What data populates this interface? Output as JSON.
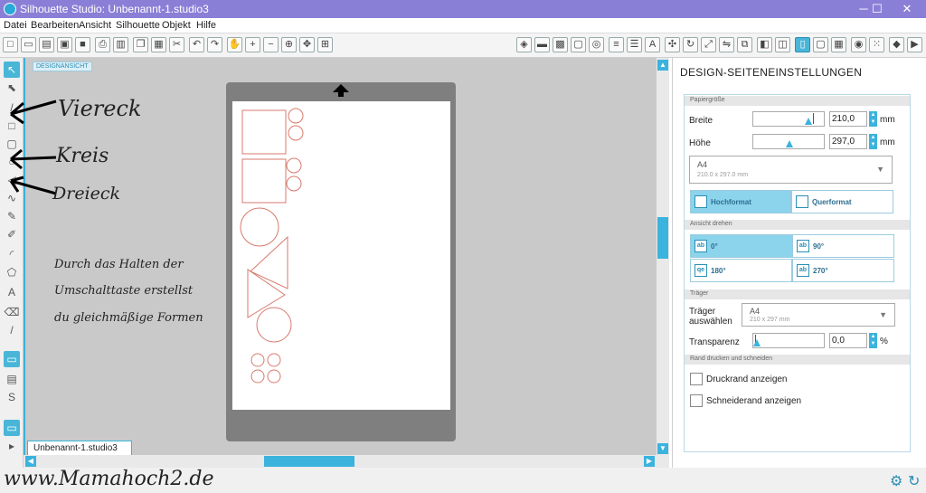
{
  "window": {
    "title": "Silhouette Studio: Unbenannt-1.studio3",
    "controls": [
      "─",
      "☐",
      "✕"
    ]
  },
  "menu": [
    "Datei",
    "Bearbeiten",
    "Ansicht",
    "Silhouette",
    "Objekt",
    "Hilfe"
  ],
  "workspace": {
    "view_label": "DESIGNANSICHT",
    "doc_tab": "Unbenannt-1.studio3",
    "doc_tab_close": "x"
  },
  "annotations": {
    "rect": "Viereck",
    "circle": "Kreis",
    "triangle": "Dreieck",
    "note_line1": "Durch das Halten der",
    "note_line2": "Umschalttaste erstellst",
    "note_line3": "du gleichmäßige Formen",
    "watermark": "www.Mamahoch2.de"
  },
  "panel": {
    "title": "DESIGN-SEITENEINSTELLUNGEN",
    "paper_section": "Papiergröße",
    "width_label": "Breite",
    "width_value": "210,0",
    "height_label": "Höhe",
    "height_value": "297,0",
    "unit_mm": "mm",
    "paper_size": "A4",
    "paper_size_sub": "210.0 x 297.0 mm",
    "portrait": "Hochformat",
    "landscape": "Querformat",
    "rotate_section": "Ansicht drehen",
    "rot0": "0°",
    "rot90": "90°",
    "rot180": "180°",
    "rot270": "270°",
    "carrier_section": "Träger",
    "carrier_label1": "Träger",
    "carrier_label2": "auswählen",
    "carrier_value": "A4",
    "carrier_sub": "210 x 297 mm",
    "transparency_label": "Transparenz",
    "transparency_value": "0,0",
    "unit_pct": "%",
    "print_section": "Rand drucken und schneiden",
    "print_border": "Druckrand anzeigen",
    "cut_border": "Schneiderand anzeigen"
  },
  "colors": {
    "accent": "#3bb3dd",
    "titlebar": "#8a7fd6",
    "shape_stroke": "#d77a6e"
  }
}
